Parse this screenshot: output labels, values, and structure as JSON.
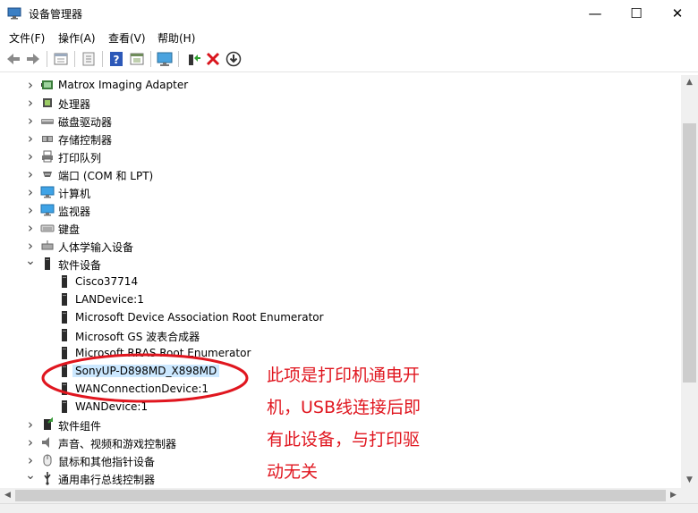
{
  "window": {
    "title": "设备管理器",
    "min": "—",
    "max": "☐",
    "close": "✕"
  },
  "menu": [
    "文件(F)",
    "操作(A)",
    "查看(V)",
    "帮助(H)"
  ],
  "toolbar_icons": [
    "back-arrow-icon",
    "forward-arrow-icon",
    "properties-view-icon",
    "update-driver-icon",
    "help-icon",
    "device-view-icon",
    "monitor-scan-icon",
    "add-driver-icon",
    "uninstall-x-icon",
    "download-driver-icon"
  ],
  "tree": [
    {
      "label": "Matrox Imaging Adapter",
      "level": 1,
      "expander": "collapsed",
      "icon": "adapter-icon"
    },
    {
      "label": "处理器",
      "level": 1,
      "expander": "collapsed",
      "icon": "processor-icon"
    },
    {
      "label": "磁盘驱动器",
      "level": 1,
      "expander": "collapsed",
      "icon": "disk-drive-icon"
    },
    {
      "label": "存储控制器",
      "level": 1,
      "expander": "collapsed",
      "icon": "storage-controller-icon"
    },
    {
      "label": "打印队列",
      "level": 1,
      "expander": "collapsed",
      "icon": "printer-icon"
    },
    {
      "label": "端口 (COM 和 LPT)",
      "level": 1,
      "expander": "collapsed",
      "icon": "port-icon"
    },
    {
      "label": "计算机",
      "level": 1,
      "expander": "collapsed",
      "icon": "computer-icon"
    },
    {
      "label": "监视器",
      "level": 1,
      "expander": "collapsed",
      "icon": "monitor-icon"
    },
    {
      "label": "键盘",
      "level": 1,
      "expander": "collapsed",
      "icon": "keyboard-icon"
    },
    {
      "label": "人体学输入设备",
      "level": 1,
      "expander": "collapsed",
      "icon": "hid-icon"
    },
    {
      "label": "软件设备",
      "level": 1,
      "expander": "expanded",
      "icon": "software-device-icon"
    },
    {
      "label": "Cisco37714",
      "level": 2,
      "icon": "software-device-icon"
    },
    {
      "label": "LANDevice:1",
      "level": 2,
      "icon": "software-device-icon"
    },
    {
      "label": "Microsoft Device Association Root Enumerator",
      "level": 2,
      "icon": "software-device-icon"
    },
    {
      "label": "Microsoft GS 波表合成器",
      "level": 2,
      "icon": "software-device-icon"
    },
    {
      "label": "Microsoft RRAS Root Enumerator",
      "level": 2,
      "icon": "software-device-icon"
    },
    {
      "label": "SonyUP-D898MD_X898MD",
      "level": 2,
      "icon": "software-device-icon",
      "selected": true
    },
    {
      "label": "WANConnectionDevice:1",
      "level": 2,
      "icon": "software-device-icon"
    },
    {
      "label": "WANDevice:1",
      "level": 2,
      "icon": "software-device-icon"
    },
    {
      "label": "软件组件",
      "level": 1,
      "expander": "collapsed",
      "icon": "software-component-icon"
    },
    {
      "label": "声音、视频和游戏控制器",
      "level": 1,
      "expander": "collapsed",
      "icon": "speaker-icon"
    },
    {
      "label": "鼠标和其他指针设备",
      "level": 1,
      "expander": "collapsed",
      "icon": "mouse-icon"
    },
    {
      "label": "通用串行总线控制器",
      "level": 1,
      "expander": "expanded",
      "icon": "usb-icon"
    }
  ],
  "annotation": {
    "lines": [
      "此项是打印机通电开",
      "机，USB线连接后即",
      "有此设备，与打印驱",
      "动无关"
    ],
    "color": "#e0161f"
  },
  "scroll": {
    "up": "▲",
    "down": "▼",
    "left": "◀",
    "right": "▶"
  }
}
